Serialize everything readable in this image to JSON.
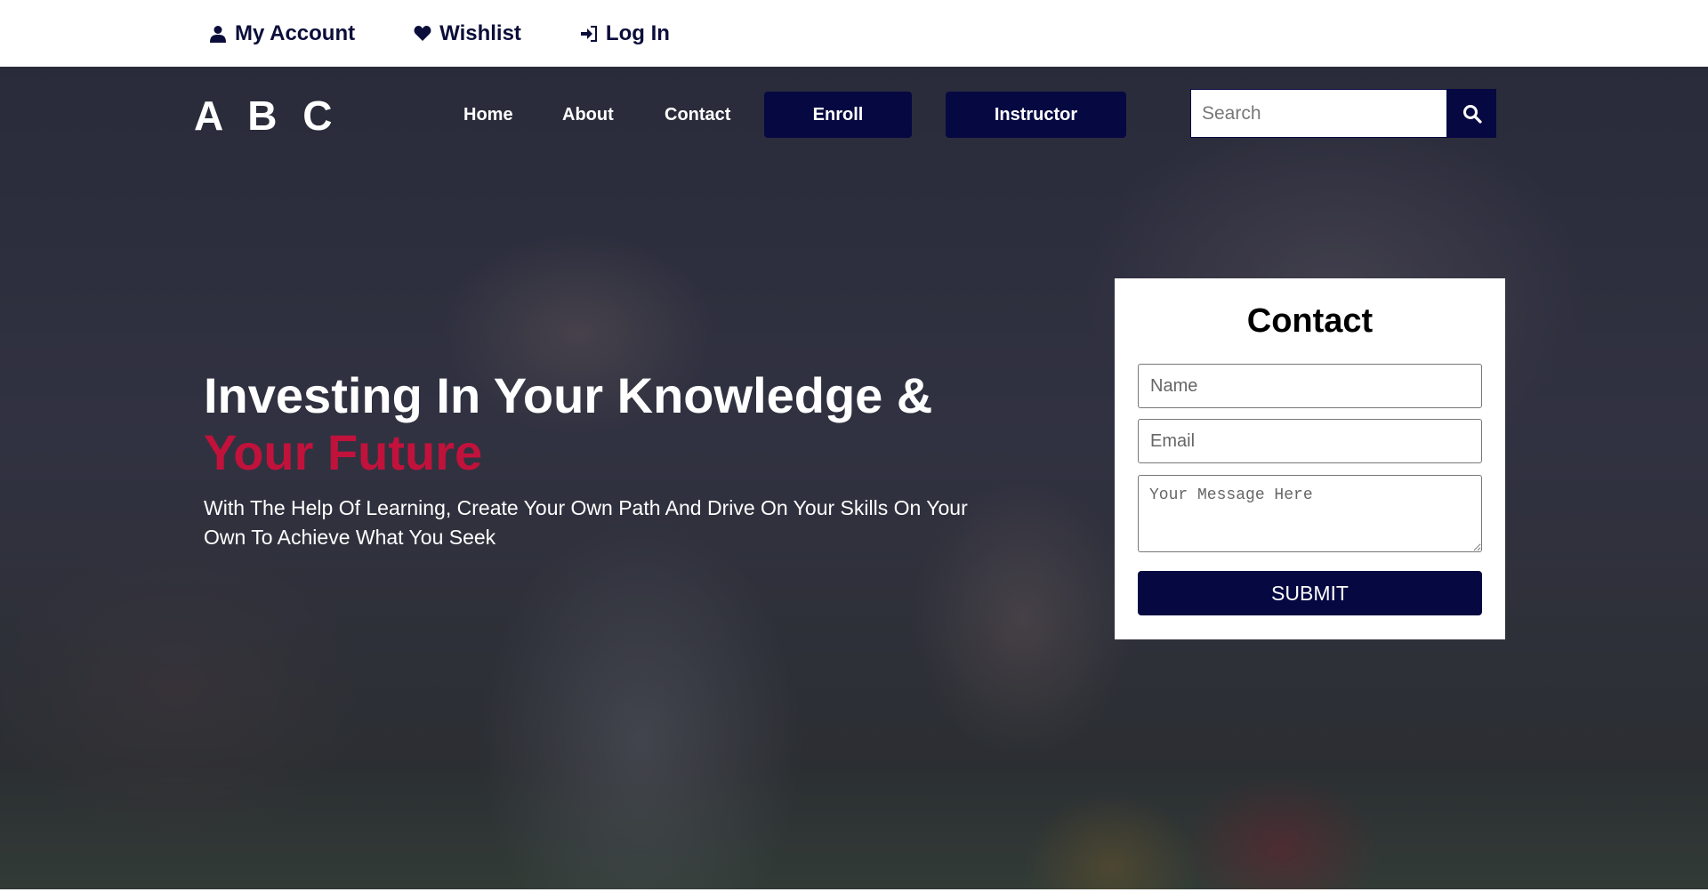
{
  "topbar": {
    "links": [
      {
        "label": "My Account",
        "icon": "user-icon"
      },
      {
        "label": "Wishlist",
        "icon": "heart-icon"
      },
      {
        "label": "Log In",
        "icon": "sign-in-icon"
      }
    ]
  },
  "header": {
    "logo": "A B C",
    "nav": {
      "home": "Home",
      "about": "About",
      "contact": "Contact",
      "enroll": "Enroll",
      "instructor": "Instructor"
    },
    "search": {
      "placeholder": "Search",
      "value": "",
      "icon": "search-icon"
    }
  },
  "hero": {
    "title_line1": "Investing In Your Knowledge &",
    "title_line2": "Your Future",
    "subtitle": "With The Help Of Learning, Create Your Own Path And Drive On Your Skills On Your Own To Achieve What You Seek"
  },
  "contact_form": {
    "title": "Contact",
    "name_placeholder": "Name",
    "email_placeholder": "Email",
    "message_placeholder": "Your Message Here",
    "submit_label": "SUBMIT"
  },
  "colors": {
    "primary_navy": "#060842",
    "accent_red": "#c1123c",
    "white": "#ffffff"
  }
}
